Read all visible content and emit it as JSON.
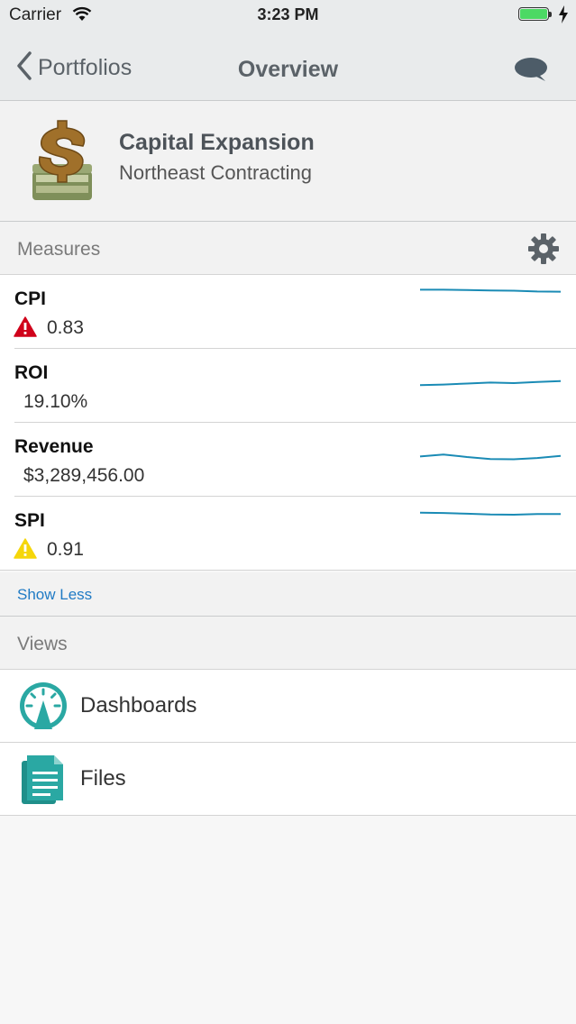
{
  "status_bar": {
    "carrier": "Carrier",
    "time": "3:23 PM"
  },
  "nav": {
    "back_label": "Portfolios",
    "title": "Overview"
  },
  "portfolio": {
    "name": "Capital Expansion",
    "company": "Northeast Contracting"
  },
  "measures": {
    "heading": "Measures",
    "items": [
      {
        "name": "CPI",
        "value": "0.83",
        "alert": "critical",
        "trend": [
          0.95,
          0.95,
          0.94,
          0.92,
          0.91,
          0.88,
          0.87
        ]
      },
      {
        "name": "ROI",
        "value": "19.10%",
        "alert": "none",
        "trend": [
          0.1,
          0.12,
          0.16,
          0.2,
          0.18,
          0.22,
          0.26
        ]
      },
      {
        "name": "Revenue",
        "value": "$3,289,456.00",
        "alert": "none",
        "trend": [
          0.2,
          0.28,
          0.18,
          0.1,
          0.09,
          0.14,
          0.22
        ]
      },
      {
        "name": "SPI",
        "value": "0.91",
        "alert": "warning",
        "trend": [
          0.9,
          0.89,
          0.86,
          0.83,
          0.82,
          0.85,
          0.85
        ]
      }
    ],
    "show_less_label": "Show Less"
  },
  "views": {
    "heading": "Views",
    "items": [
      {
        "label": "Dashboards",
        "icon": "gauge-icon"
      },
      {
        "label": "Files",
        "icon": "document-icon"
      }
    ]
  },
  "colors": {
    "accent": "#1f7ac4",
    "sparkline": "#1a8bb5",
    "critical": "#d0021b",
    "warning": "#f5d60a",
    "view_icon": "#2aa8a3"
  }
}
